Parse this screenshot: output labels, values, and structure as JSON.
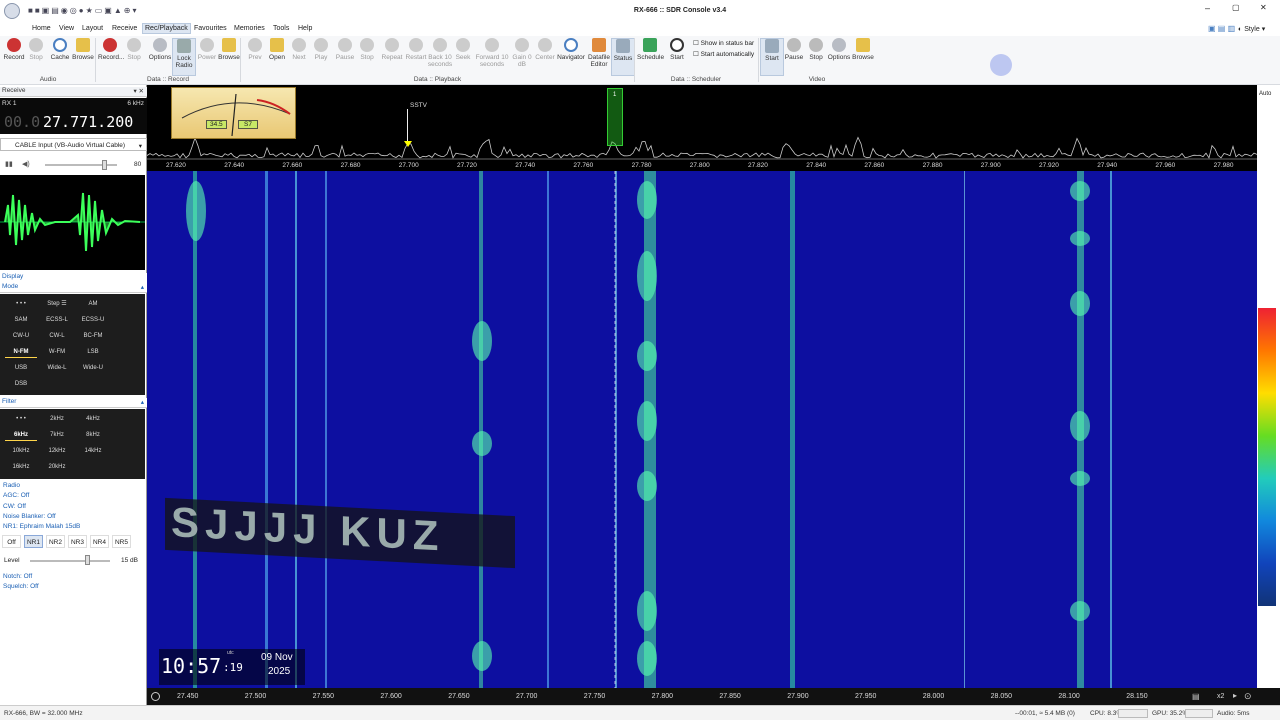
{
  "window": {
    "title": "RX-666 :: SDR Console v3.4",
    "style_label": "Style"
  },
  "menu": [
    "Home",
    "View",
    "Layout",
    "Receive",
    "Rec/Playback",
    "Favourites",
    "Memories",
    "Tools",
    "Help"
  ],
  "menu_active": "Rec/Playback",
  "ribbon": {
    "audio": {
      "group": "Audio",
      "buttons": [
        "Record",
        "Stop",
        "Cache",
        "Browse"
      ]
    },
    "data_record": {
      "group": "Data :: Record",
      "buttons": [
        "Record...",
        "Stop",
        "Options",
        "Lock Radio",
        "Power",
        "Browse"
      ]
    },
    "data_playback": {
      "group": "Data :: Playback",
      "buttons": [
        "Prev",
        "Open",
        "Next",
        "Play",
        "Pause",
        "Stop",
        "Repeat",
        "Restart",
        "Back 10 seconds",
        "Seek",
        "Forward 10 seconds",
        "Gain 0 dB",
        "Center",
        "Navigator",
        "Datafile Editor",
        "Status"
      ]
    },
    "data_scheduler": {
      "group": "Data :: Scheduler",
      "buttons": [
        "Schedule",
        "Start"
      ],
      "checkboxes": [
        "Show in status bar",
        "Start automatically"
      ]
    },
    "video": {
      "group": "Video",
      "buttons": [
        "Start",
        "Pause",
        "Stop",
        "Options",
        "Browse"
      ]
    }
  },
  "receive": {
    "panel_title": "Receive",
    "rx_label": "RX 1",
    "bandwidth": "6 kHz",
    "freq_dim": "00.0",
    "freq_main": "27.771.200",
    "input": "CABLE Input (VB-Audio Virtual Cable)",
    "volume": "80"
  },
  "display": {
    "title": "Display",
    "mode_title": "Mode"
  },
  "modes": [
    [
      "• • •",
      "Step ☰",
      "AM"
    ],
    [
      "SAM",
      "ECSS-L",
      "ECSS-U"
    ],
    [
      "CW-U",
      "CW-L",
      "BC-FM"
    ],
    [
      "N-FM",
      "W-FM",
      "LSB"
    ],
    [
      "USB",
      "Wide-L",
      "Wide-U"
    ],
    [
      "DSB",
      "",
      ""
    ]
  ],
  "mode_selected": "N-FM",
  "filter": {
    "title": "Filter",
    "items": [
      [
        "• • •",
        "2kHz",
        "4kHz"
      ],
      [
        "6kHz",
        "7kHz",
        "8kHz"
      ],
      [
        "10kHz",
        "12kHz",
        "14kHz"
      ],
      [
        "16kHz",
        "20kHz",
        ""
      ]
    ],
    "selected": "6kHz"
  },
  "settings": {
    "radio": "Radio",
    "agc": "AGC: Off",
    "cw": "CW: Off",
    "noise_blanker": "Noise Blanker: Off",
    "nr": "NR1: Ephraim Malah 15dB",
    "nr_buttons": [
      "Off",
      "NR1",
      "NR2",
      "NR3",
      "NR4",
      "NR5"
    ],
    "nr_selected": "NR1",
    "level_label": "Level",
    "level_value": "15 dB",
    "notch": "Notch: Off",
    "squelch": "Squelch: Off"
  },
  "spectrum": {
    "marker_label": "SSTV",
    "meter_value": "34.5",
    "meter_s": "S7",
    "freq_ticks": [
      "27.620",
      "27.640",
      "27.660",
      "27.680",
      "27.700",
      "27.720",
      "27.740",
      "27.760",
      "27.780",
      "27.800",
      "27.820",
      "27.840",
      "27.860",
      "27.880",
      "27.900",
      "27.920",
      "27.940",
      "27.960",
      "27.980"
    ],
    "auto_label": "Auto"
  },
  "waterfall": {
    "clock_time": "10:57",
    "clock_seconds": ":19",
    "clock_utc": "utc",
    "clock_date": "09 Nov",
    "clock_year": "2025",
    "overlay_text": "SJJJJ KUZ"
  },
  "bottom_axis": {
    "ticks": [
      "27.450",
      "27.500",
      "27.550",
      "27.600",
      "27.650",
      "27.700",
      "27.750",
      "27.800",
      "27.850",
      "27.900",
      "27.950",
      "28.000",
      "28.050",
      "28.100",
      "28.150"
    ],
    "zoom": "x2"
  },
  "status": {
    "left": "RX-666, BW = 32.000 MHz",
    "time": "--00:01, ≈ 5.4 MB (0)",
    "cpu": "CPU: 8.3%",
    "gpu": "GPU: 35.2%",
    "audio": "Audio: 5ms"
  },
  "colors": {
    "accent": "#1a5fb4",
    "waterfall_bg": "#0d0fa0",
    "signal": "#3cf0a0"
  }
}
